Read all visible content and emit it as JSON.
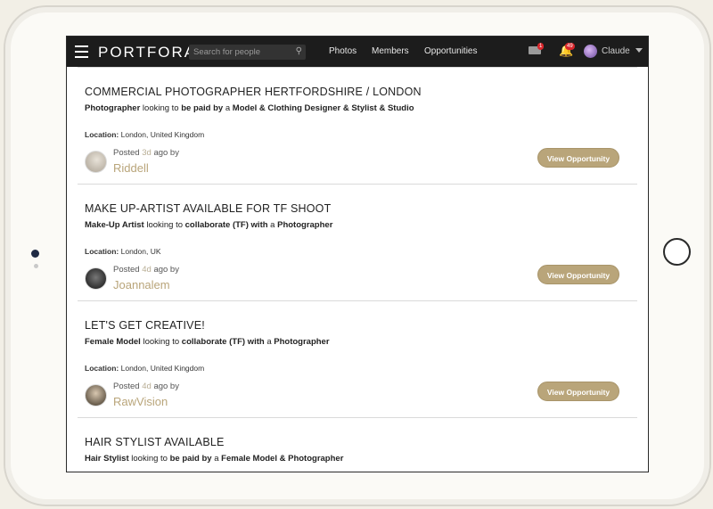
{
  "header": {
    "brand": "PORTFORA",
    "search_placeholder": "Search for people",
    "nav": [
      "Photos",
      "Members",
      "Opportunities"
    ],
    "messages_badge": "1",
    "notifications_badge": "49",
    "username": "Claude"
  },
  "opportunities": [
    {
      "title": "COMMERCIAL PHOTOGRAPHER HERTFORDSHIRE / LONDON",
      "role": "Photographer",
      "relation": "be paid by",
      "target": "Model & Clothing Designer & Stylist & Studio",
      "location_label": "Location:",
      "location": "London, United Kingdom",
      "posted_ago": "3d",
      "poster": "Riddell",
      "button": "View Opportunity"
    },
    {
      "title": "MAKE UP-ARTIST AVAILABLE FOR TF SHOOT",
      "role": "Make-Up Artist",
      "relation": "collaborate (TF) with",
      "target": "Photographer",
      "location_label": "Location:",
      "location": "London, UK",
      "posted_ago": "4d",
      "poster": "Joannalem",
      "button": "View Opportunity"
    },
    {
      "title": "LET'S GET CREATIVE!",
      "role": "Female Model",
      "relation": "collaborate (TF) with",
      "target": "Photographer",
      "location_label": "Location:",
      "location": "London, United Kingdom",
      "posted_ago": "4d",
      "poster": "RawVision",
      "button": "View Opportunity"
    },
    {
      "title": "HAIR STYLIST AVAILABLE",
      "role": "Hair Stylist",
      "relation": "be paid by",
      "target": "Female Model & Photographer"
    }
  ],
  "text": {
    "looking_to": "looking to",
    "a": "a",
    "posted": "Posted",
    "ago_by": "ago by"
  },
  "colors": {
    "accent": "#b9a57a",
    "topbar": "#1c1c1c",
    "badge": "#d8262b"
  }
}
